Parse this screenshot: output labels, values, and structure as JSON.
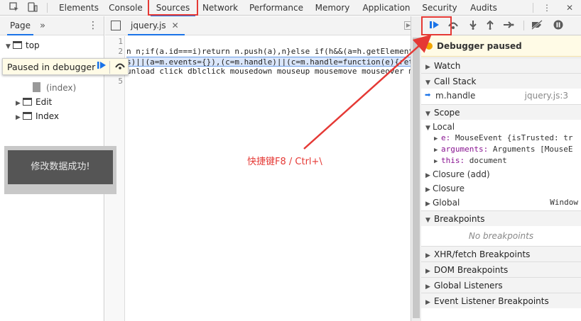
{
  "tabs": [
    "Elements",
    "Console",
    "Sources",
    "Network",
    "Performance",
    "Memory",
    "Application",
    "Security",
    "Audits"
  ],
  "navigator": {
    "tab_label": "Page",
    "more_label": "»",
    "tree": [
      {
        "label": "top"
      },
      {
        "label": "(index)"
      },
      {
        "label": "Edit"
      },
      {
        "label": "Index"
      }
    ]
  },
  "editor": {
    "file_tab": "jquery.js",
    "line_numbers": [
      "1",
      "2",
      "3",
      "4",
      "5"
    ],
    "lines": [
      "",
      "n n;if(a.id===i)return n.push(a),n}else if(h&&(a=h.getElementB",
      "s)||(a=m.events={}),(c=m.handle)||(c=m.handle=function(e){ret",
      "unload click dblclick mousedown mouseup mousemove mouseover m",
      ""
    ]
  },
  "debugger": {
    "paused_text": "Debugger paused",
    "sections": {
      "watch": "Watch",
      "call_stack": "Call Stack",
      "scope": "Scope",
      "breakpoints": "Breakpoints",
      "xhr": "XHR/fetch Breakpoints",
      "dom": "DOM Breakpoints",
      "global_listeners": "Global Listeners",
      "event_listeners": "Event Listener Breakpoints"
    },
    "call_stack": [
      {
        "fn": "m.handle",
        "loc": "jquery.js:3"
      }
    ],
    "scope": {
      "local_label": "Local",
      "local": [
        {
          "key": "e",
          "value": "MouseEvent {isTrusted: tr"
        },
        {
          "key": "arguments",
          "value": "Arguments [MouseE"
        },
        {
          "key": "this",
          "value": "document"
        }
      ],
      "closure_add": "Closure (add)",
      "closure": "Closure",
      "global_label": "Global",
      "global_value": "Window"
    },
    "no_breakpoints": "No breakpoints"
  },
  "overlay": {
    "paused_label": "Paused in debugger"
  },
  "toast": "修改数据成功!",
  "annotation": "快捷键F8 / Ctrl+\\",
  "colors": {
    "accent": "#1a73e8",
    "highlight_red": "#e53935",
    "paused_bg": "#fffbe6"
  }
}
